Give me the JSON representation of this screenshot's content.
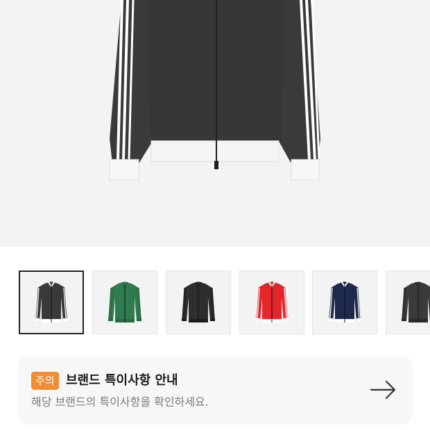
{
  "hero": {
    "image": "jacket-dark-grey-front"
  },
  "thumbnails": [
    {
      "name": "dark-grey",
      "body": "#3a3a3a",
      "trim": "#ffffff",
      "selected": true
    },
    {
      "name": "green",
      "body": "#2f7a4e",
      "trim": "#2a6a43",
      "selected": false
    },
    {
      "name": "black",
      "body": "#2e2e30",
      "trim": "#1e1e1e",
      "selected": false
    },
    {
      "name": "red",
      "body": "#e3262b",
      "trim": "#ffffff",
      "selected": false
    },
    {
      "name": "navy",
      "body": "#1e2a4d",
      "trim": "#ffffff",
      "selected": false
    },
    {
      "name": "charcoal",
      "body": "#3a3a3a",
      "trim": "#2a2a2a",
      "selected": false
    }
  ],
  "notice": {
    "badge": "주의",
    "title": "브랜드 특이사항 안내",
    "description": "해당 브랜드의 특이사항을 확인하세요.",
    "arrow_icon": "arrow-right-icon"
  }
}
